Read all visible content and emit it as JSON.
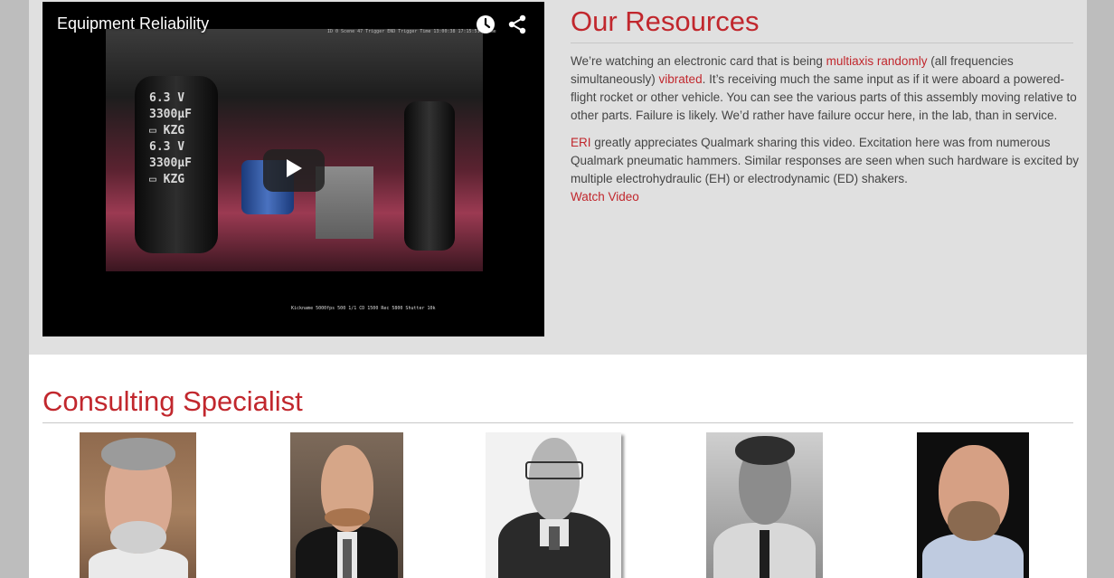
{
  "resources": {
    "title": "Our Resources",
    "video": {
      "title": "Equipment Reliability",
      "icons": [
        "clock-icon",
        "share-icon",
        "play-icon"
      ]
    },
    "p1": {
      "t1": "We’re watching an electronic card that is being ",
      "link1": "multiaxis randomly",
      "t2": " (all frequencies simultaneously) ",
      "link2": "vibrated",
      "t3": ". It’s receiving much the same input as if it were aboard a powered-flight rocket or other vehicle. You can see the various parts of this assembly moving relative to other parts. Failure is likely. We’d rather have failure occur here, in the lab, than in service."
    },
    "p2": {
      "link1": "ERI",
      "t1": " greatly appreciates Qualmark sharing this video. Excitation here was from numerous Qualmark pneumatic hammers. Similar responses are seen when such hardware is excited by multiple electrohydraulic (EH) or electrodynamic (ED) shakers."
    },
    "watch_video": "Watch Video"
  },
  "consulting": {
    "title": "Consulting Specialist"
  },
  "colors": {
    "accent": "#c1272d",
    "text": "#444444",
    "gray_bg": "#e0e0e0"
  }
}
